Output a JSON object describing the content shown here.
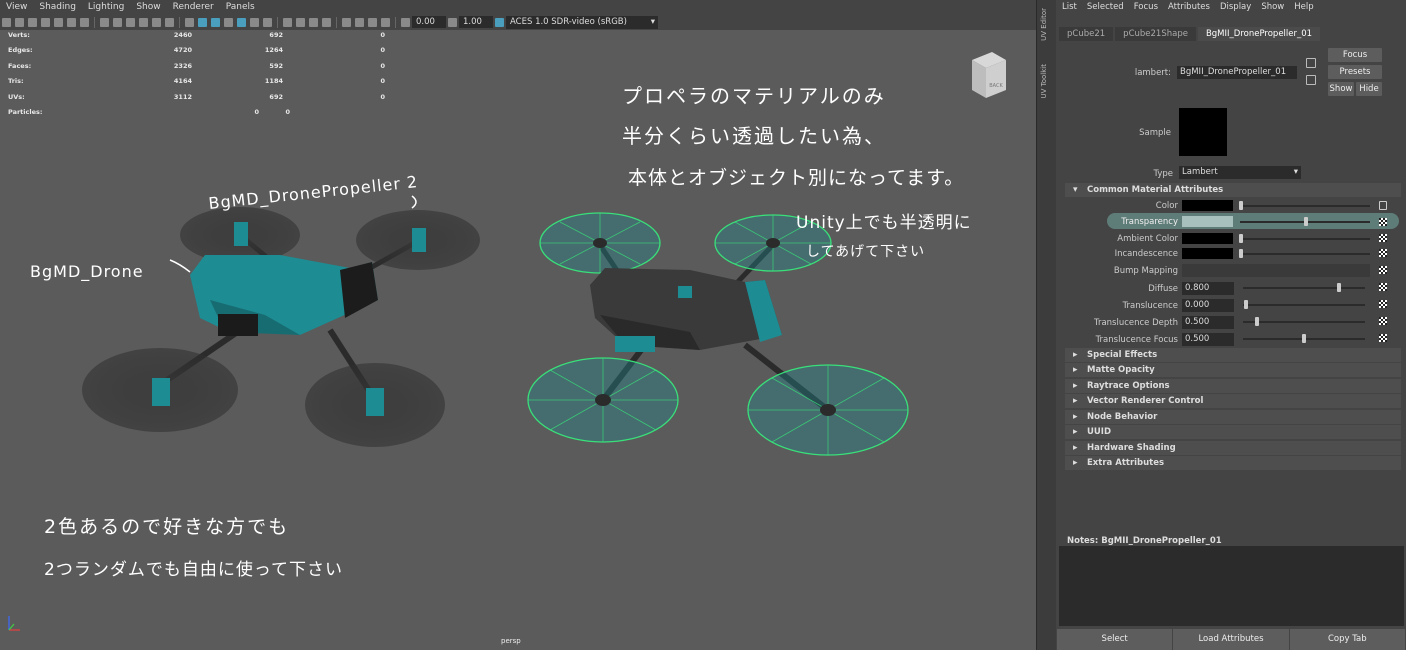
{
  "viewport": {
    "menu": [
      "View",
      "Shading",
      "Lighting",
      "Show",
      "Renderer",
      "Panels"
    ],
    "gamma": "0.00",
    "exposure": "1.00",
    "color_mgmt": "ACES 1.0 SDR-video (sRGB)",
    "hud": [
      {
        "label": "Verts:",
        "a": "2460",
        "b": "692",
        "c": "0"
      },
      {
        "label": "Edges:",
        "a": "4720",
        "b": "1264",
        "c": "0"
      },
      {
        "label": "Faces:",
        "a": "2326",
        "b": "592",
        "c": "0"
      },
      {
        "label": "Tris:",
        "a": "4164",
        "b": "1184",
        "c": "0"
      },
      {
        "label": "UVs:",
        "a": "3112",
        "b": "692",
        "c": "0"
      },
      {
        "label": "Particles:",
        "a": "",
        "b": "0",
        "c": "0"
      }
    ],
    "camera": "persp",
    "cube_face": "BACK",
    "annotations": {
      "propeller_label": "BgMD_DronePropeller",
      "propeller_suffix": "2",
      "drone_label": "BgMD_Drone",
      "note1_l1": "プロペラのマテリアルのみ",
      "note1_l2": "半分くらい透過したい為、",
      "note1_l3": "本体とオブジェクト別になってます。",
      "note2_l1": "Unity上でも半透明に",
      "note2_l2": "してあげて下さい",
      "note3_l1": "2色あるので好きな方でも",
      "note3_l2": "2つランダムでも自由に使って下さい"
    }
  },
  "side_tabs": [
    "UV Editor",
    "UV Toolkit"
  ],
  "ae": {
    "menu": [
      "List",
      "Selected",
      "Focus",
      "Attributes",
      "Display",
      "Show",
      "Help"
    ],
    "tabs": [
      "pCube21",
      "pCube21Shape",
      "BgMII_DronePropeller_01"
    ],
    "material_label": "lambert:",
    "material_name": "BgMII_DronePropeller_01",
    "focus": "Focus",
    "presets": "Presets",
    "show": "Show",
    "hide": "Hide",
    "sample": "Sample",
    "type_label": "Type",
    "type_value": "Lambert",
    "section_common": "Common Material Attributes",
    "color": "Color",
    "transparency": "Transparency",
    "ambient": "Ambient Color",
    "incandescence": "Incandescence",
    "bump": "Bump Mapping",
    "diffuse": "Diffuse",
    "diffuse_v": "0.800",
    "translucence": "Translucence",
    "translucence_v": "0.000",
    "tdepth": "Translucence Depth",
    "tdepth_v": "0.500",
    "tfocus": "Translucence Focus",
    "tfocus_v": "0.500",
    "sections": [
      "Special Effects",
      "Matte Opacity",
      "Raytrace Options",
      "Vector Renderer Control",
      "Node Behavior",
      "UUID",
      "Hardware Shading",
      "Extra Attributes"
    ],
    "notes_label": "Notes:",
    "notes_name": "BgMII_DronePropeller_01",
    "bottom": [
      "Select",
      "Load Attributes",
      "Copy Tab"
    ]
  },
  "colors": {
    "bg": "#5b5b5b",
    "teal": "#1e8c93",
    "wire": "#39e07a",
    "panel": "#444444"
  }
}
